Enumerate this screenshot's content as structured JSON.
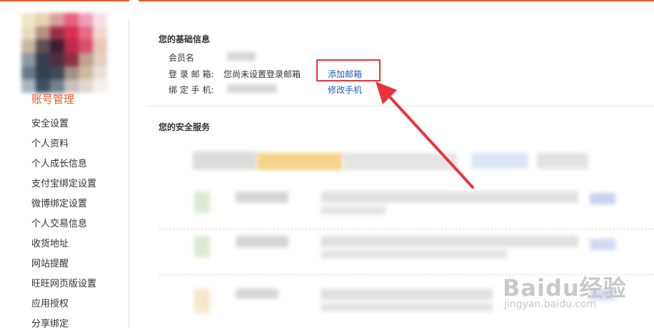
{
  "sidebar": {
    "title": "账号管理",
    "items": [
      {
        "label": "安全设置"
      },
      {
        "label": "个人资料"
      },
      {
        "label": "个人成长信息"
      },
      {
        "label": "支付宝绑定设置"
      },
      {
        "label": "微博绑定设置"
      },
      {
        "label": "个人交易信息"
      },
      {
        "label": "收货地址"
      },
      {
        "label": "网站提醒"
      },
      {
        "label": "旺旺网页版设置"
      },
      {
        "label": "应用授权"
      },
      {
        "label": "分享绑定"
      }
    ]
  },
  "basic_info": {
    "title": "您的基础信息",
    "member_label": "会员名",
    "email_label": "登 录 邮 箱:",
    "email_value": "您尚未设置登录邮箱",
    "email_action": "添加邮箱",
    "phone_label": "绑 定 手 机:",
    "phone_action": "修改手机"
  },
  "security": {
    "title": "您的安全服务"
  },
  "watermark": {
    "main": "Baidu经验",
    "sub": "jingyan.baidu.com"
  },
  "colors": {
    "accent": "#e45e2c",
    "link": "#1e5ebd",
    "annotation": "#e8343a"
  }
}
